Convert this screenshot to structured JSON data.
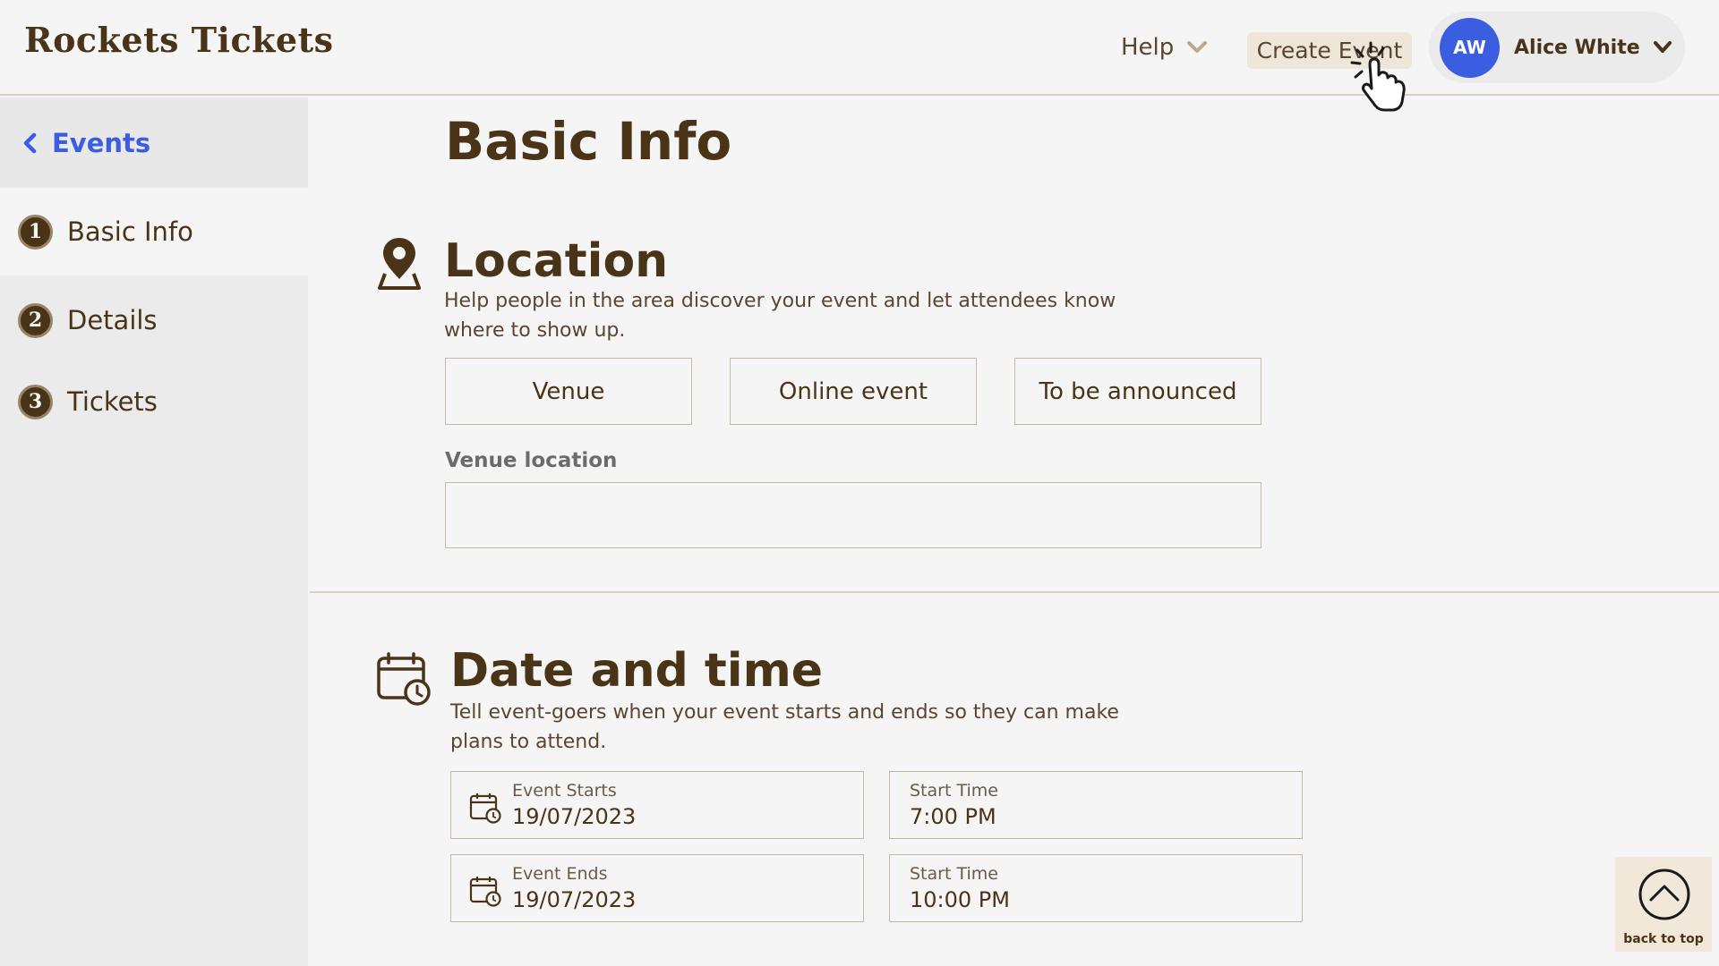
{
  "header": {
    "brand": "Rockets Tickets",
    "help_label": "Help",
    "create_event_label": "Create Event",
    "user": {
      "initials": "AW",
      "name": "Alice White",
      "avatar_color": "#3b5de0"
    }
  },
  "sidebar": {
    "back_label": "Events",
    "steps": [
      {
        "num": "1",
        "label": "Basic Info",
        "active": true
      },
      {
        "num": "2",
        "label": "Details",
        "active": false
      },
      {
        "num": "3",
        "label": "Tickets",
        "active": false
      }
    ]
  },
  "main": {
    "page_title": "Basic Info",
    "location": {
      "title": "Location",
      "description": "Help people in the area discover your event and let attendees know where to show up.",
      "options": [
        "Venue",
        "Online event",
        "To be announced"
      ],
      "venue_label": "Venue location",
      "venue_value": ""
    },
    "datetime": {
      "title": "Date and time",
      "description": "Tell event-goers when your event starts and ends so they can make plans to attend.",
      "event_starts": {
        "label": "Event Starts",
        "value": "19/07/2023"
      },
      "start_time_1": {
        "label": "Start Time",
        "value": "7:00 PM"
      },
      "event_ends": {
        "label": "Event Ends",
        "value": "19/07/2023"
      },
      "start_time_2": {
        "label": "Start Time",
        "value": "10:00 PM"
      }
    },
    "back_to_top": "back to top"
  },
  "colors": {
    "brand_brown": "#4a3418",
    "accent_blue": "#3b5de0",
    "background": "#f5f5f5",
    "sidebar_bg": "#ebebeb"
  },
  "icons": [
    "chevron-down-icon",
    "pointer-cursor-icon",
    "chevron-left-icon",
    "map-pin-icon",
    "calendar-clock-icon",
    "arrow-up-circle-icon"
  ]
}
